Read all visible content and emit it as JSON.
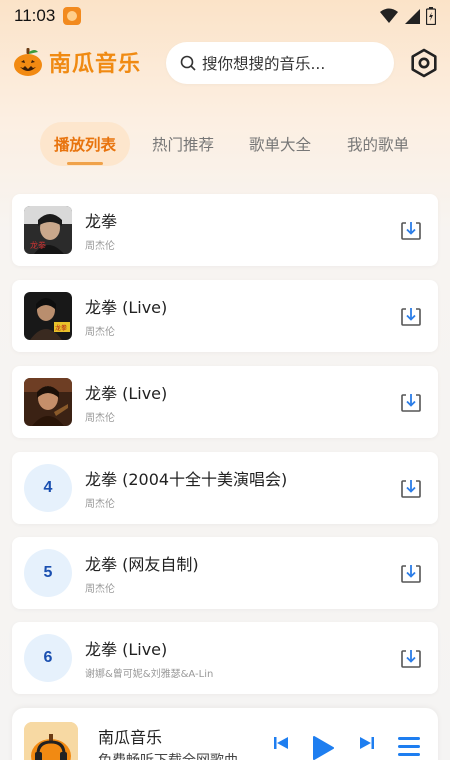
{
  "status": {
    "time": "11:03"
  },
  "app": {
    "name": "南瓜音乐"
  },
  "search": {
    "placeholder": "搜你想搜的音乐..."
  },
  "tabs": [
    {
      "label": "播放列表",
      "active": true
    },
    {
      "label": "热门推荐",
      "active": false
    },
    {
      "label": "歌单大全",
      "active": false
    },
    {
      "label": "我的歌单",
      "active": false
    }
  ],
  "songs": [
    {
      "title": "龙拳",
      "artist": "周杰伦",
      "thumb": "cover-art",
      "number": ""
    },
    {
      "title": "龙拳 (Live)",
      "artist": "周杰伦",
      "thumb": "cover-art",
      "number": ""
    },
    {
      "title": "龙拳 (Live)",
      "artist": "周杰伦",
      "thumb": "cover-art",
      "number": ""
    },
    {
      "title": "龙拳 (2004十全十美演唱会)",
      "artist": "周杰伦",
      "thumb": "number",
      "number": "4"
    },
    {
      "title": "龙拳 (网友自制)",
      "artist": "周杰伦",
      "thumb": "number",
      "number": "5"
    },
    {
      "title": "龙拳 (Live)",
      "artist": "谢娜&曾可妮&刘雅瑟&A-Lin",
      "thumb": "number",
      "number": "6"
    }
  ],
  "player": {
    "title": "南瓜音乐",
    "subtitle": "免费畅听下载全网歌曲"
  },
  "colors": {
    "accent": "#f08a12",
    "active_tab_bg": "#fde6cd",
    "player_blue": "#1e7ef0"
  }
}
